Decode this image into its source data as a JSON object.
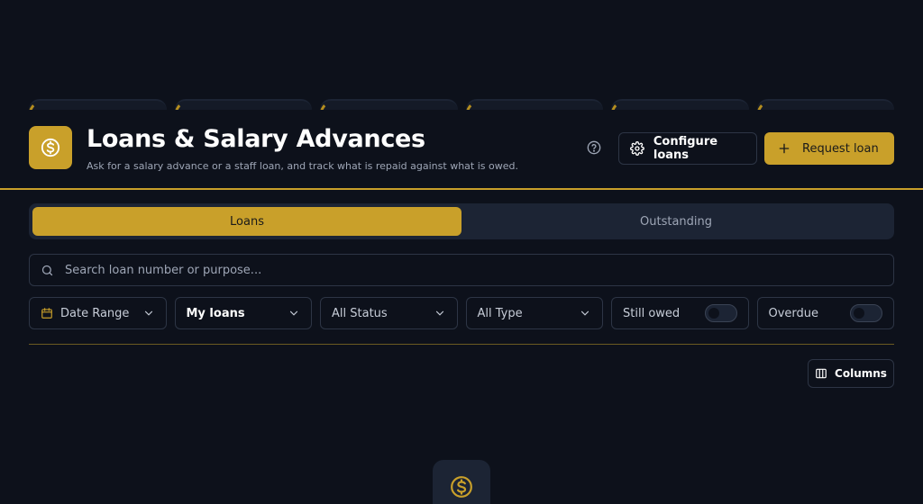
{
  "header": {
    "title": "Loans & Salary Advances",
    "subtitle": "Ask for a salary advance or a staff loan, and track what is repaid against what is owed.",
    "configure_label": "Configure loans",
    "request_label": "Request loan"
  },
  "tabs": [
    {
      "label": "Loans",
      "active": true
    },
    {
      "label": "Outstanding",
      "active": false
    }
  ],
  "search": {
    "placeholder": "Search loan number or purpose..."
  },
  "filters": {
    "date_range": "Date Range",
    "owner": "My loans",
    "status": "All Status",
    "type": "All Type",
    "still_owed": {
      "label": "Still owed",
      "on": false
    },
    "overdue": {
      "label": "Overdue",
      "on": false
    }
  },
  "toolbar": {
    "columns_label": "Columns"
  },
  "colors": {
    "accent": "#c9a02a",
    "background": "#0d111b",
    "surface": "#1c2434",
    "border": "#2d3545",
    "muted_text": "#9ea6b6"
  },
  "icons": {
    "logo": "dollar-circle-icon",
    "help": "question-circle-icon",
    "configure": "gear-icon",
    "request": "plus-icon",
    "search": "search-icon",
    "date": "calendar-icon",
    "dropdown": "chevron-down-icon",
    "columns": "columns-icon",
    "empty": "dollar-circle-icon"
  }
}
